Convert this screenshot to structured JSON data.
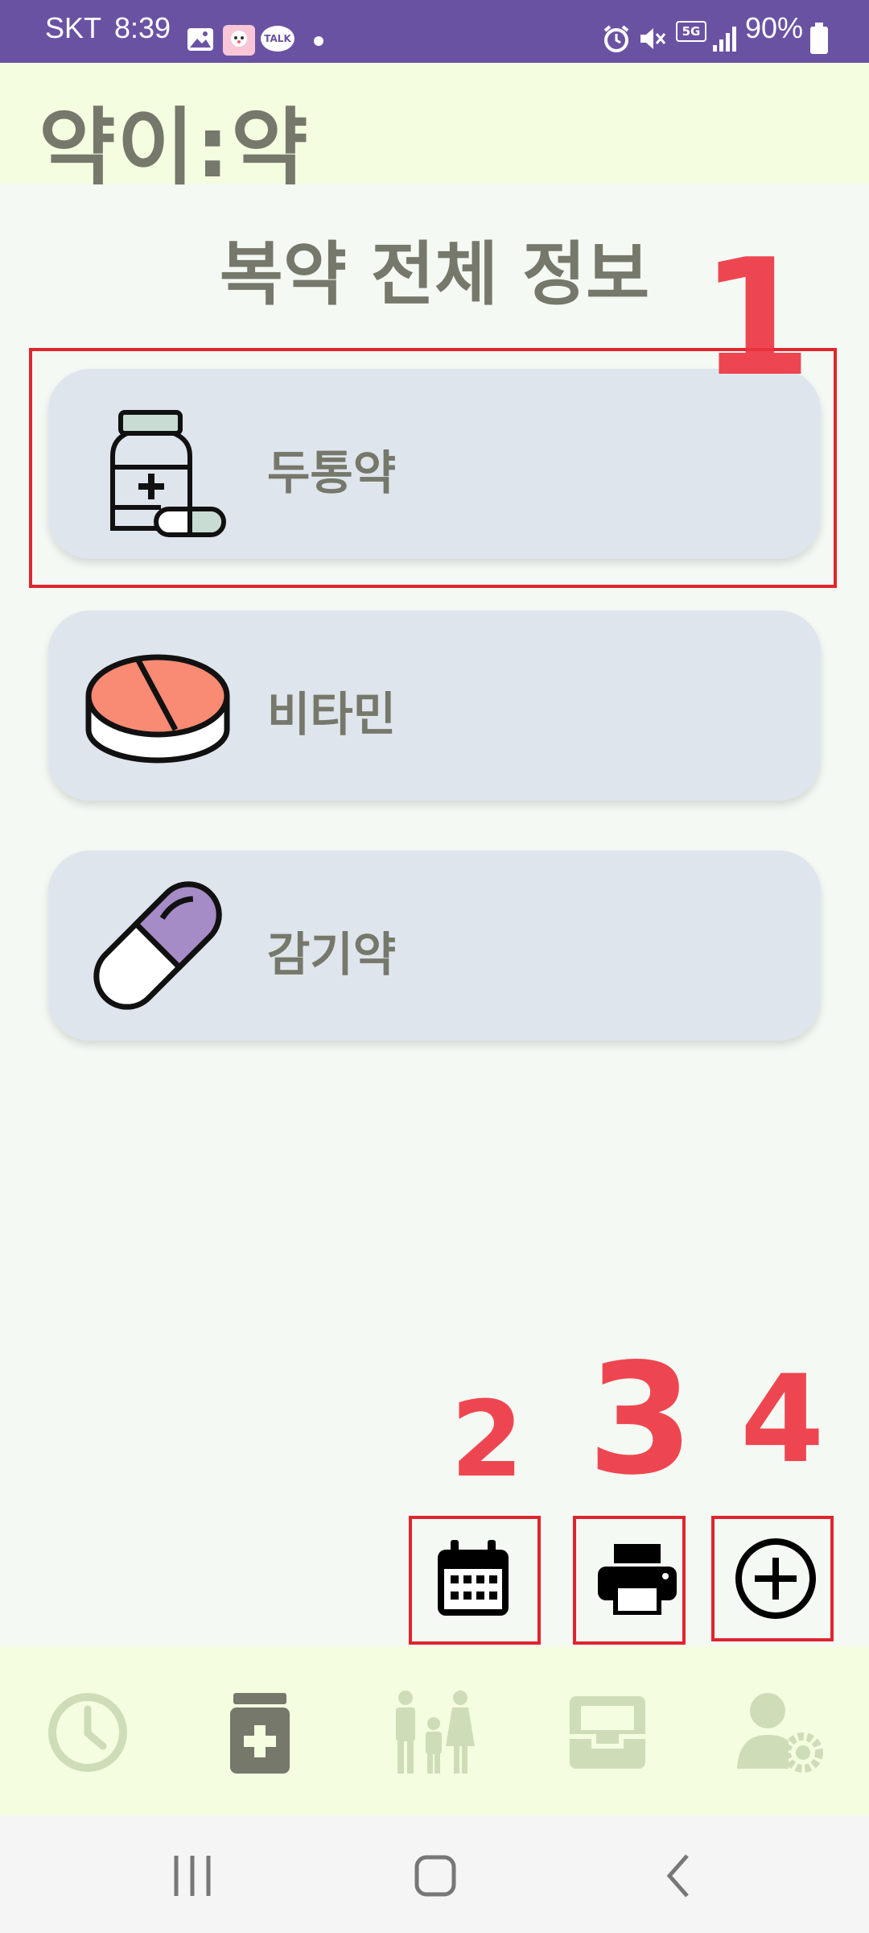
{
  "status_bar": {
    "carrier": "SKT",
    "time": "8:39",
    "battery": "90%",
    "talk_badge": "TALK",
    "network": "5G"
  },
  "header": {
    "app_title": "약이:약"
  },
  "page": {
    "title": "복약 전체 정보"
  },
  "medications": [
    {
      "name": "두통약",
      "icon": "medicine-bottle-icon"
    },
    {
      "name": "비타민",
      "icon": "tablet-icon"
    },
    {
      "name": "감기약",
      "icon": "capsule-icon"
    }
  ],
  "actions": [
    {
      "name": "calendar",
      "icon": "calendar-icon"
    },
    {
      "name": "print",
      "icon": "printer-icon"
    },
    {
      "name": "add",
      "icon": "plus-circle-icon"
    }
  ],
  "annotations": [
    "1",
    "2",
    "3",
    "4"
  ],
  "bottom_nav": [
    {
      "icon": "clock-icon",
      "active": false
    },
    {
      "icon": "medical-kit-icon",
      "active": true
    },
    {
      "icon": "family-icon",
      "active": false
    },
    {
      "icon": "inbox-icon",
      "active": false
    },
    {
      "icon": "user-settings-icon",
      "active": false
    }
  ],
  "colors": {
    "status_bar": "#6a52a3",
    "header_bg": "#f4fde0",
    "page_bg": "#f4f9f4",
    "card_bg": "#dfe5ec",
    "text": "#75786a",
    "annotation": "#e0252f",
    "nav_inactive": "#cfdcb8",
    "nav_active": "#75786a"
  }
}
